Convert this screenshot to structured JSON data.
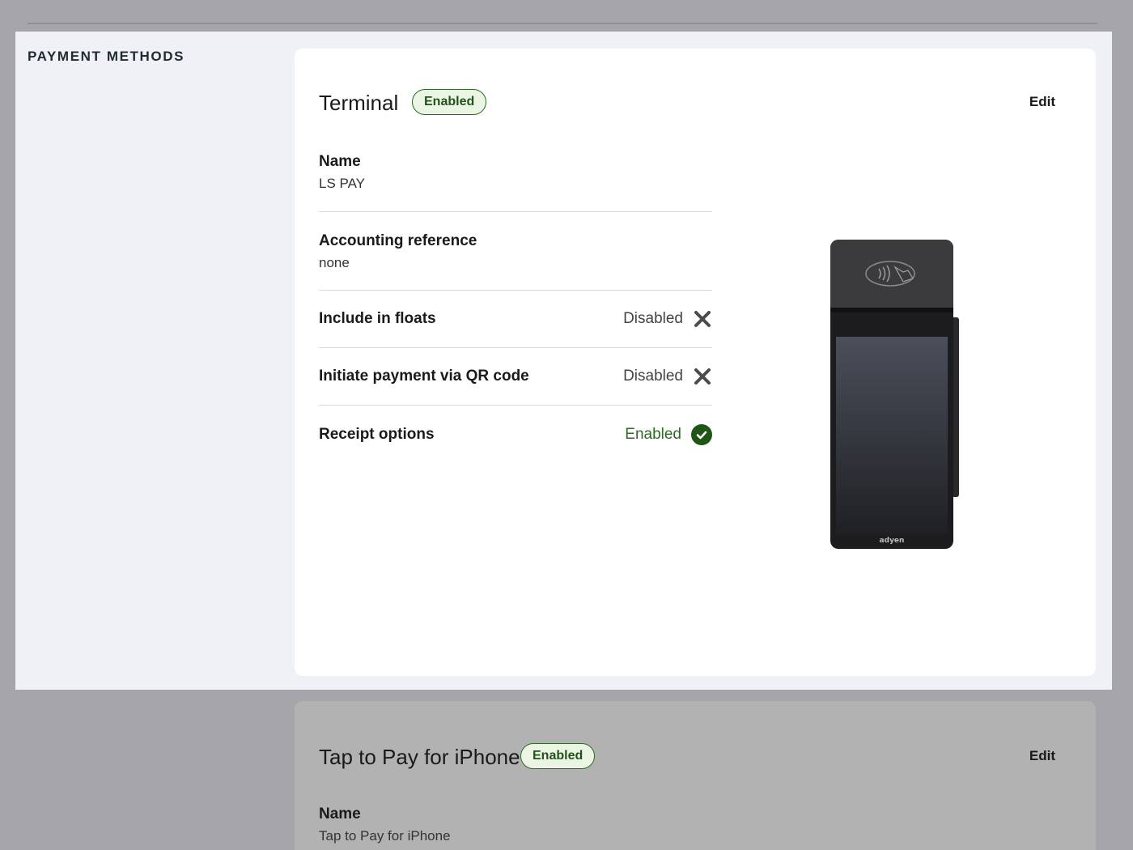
{
  "section": {
    "title": "PAYMENT METHODS"
  },
  "terminal": {
    "title": "Terminal",
    "badge": "Enabled",
    "edit_label": "Edit",
    "fields": {
      "name": {
        "label": "Name",
        "value": "LS PAY"
      },
      "accounting": {
        "label": "Accounting reference",
        "value": "none"
      },
      "floats": {
        "label": "Include in floats",
        "status": "Disabled",
        "icon": "x-icon"
      },
      "qr": {
        "label": "Initiate payment via QR code",
        "status": "Disabled",
        "icon": "x-icon"
      },
      "receipt": {
        "label": "Receipt options",
        "status": "Enabled",
        "icon": "check-circle-icon"
      }
    },
    "device_brand": "adyen"
  },
  "tap_to_pay": {
    "title": "Tap to Pay for iPhone",
    "badge": "Enabled",
    "edit_label": "Edit",
    "fields": {
      "name": {
        "label": "Name",
        "value": "Tap to Pay for iPhone"
      }
    }
  },
  "colors": {
    "enabled_green": "#2e6b24",
    "badge_bg": "#eaf5e4",
    "section_bg": "#f0f1f6",
    "overlay_gray": "#a6a6aa"
  }
}
